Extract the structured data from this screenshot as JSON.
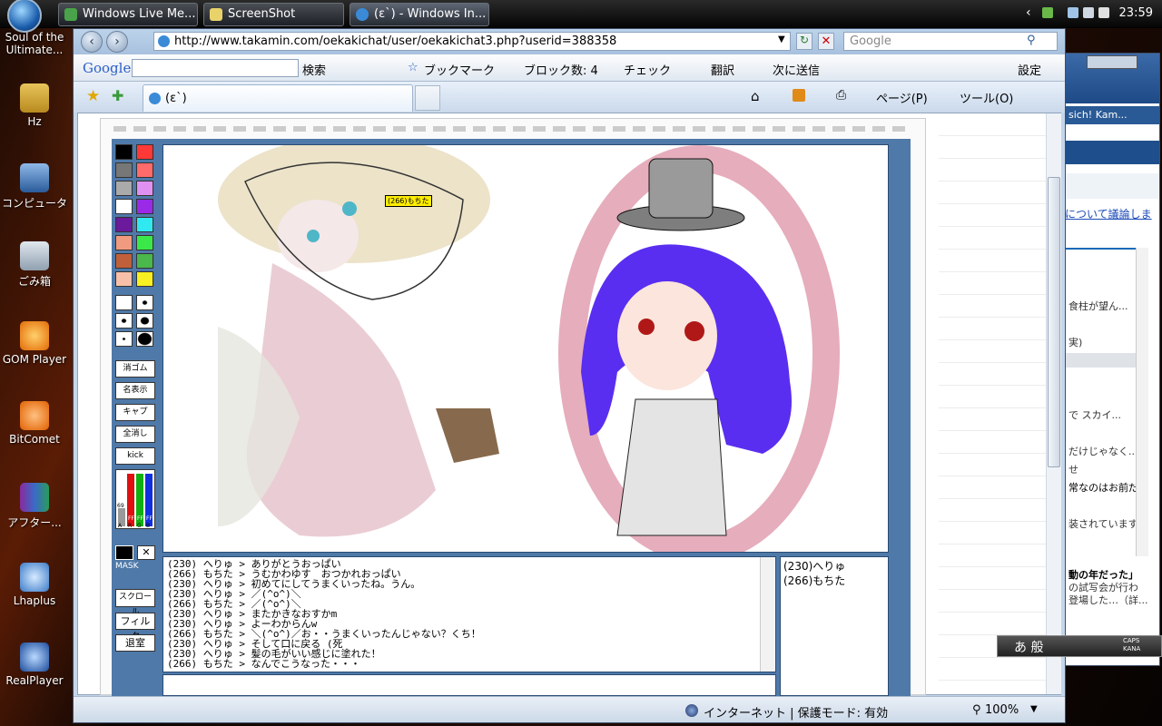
{
  "taskbar": {
    "buttons": [
      "Windows Live Me...",
      "ScreenShot",
      "(ε`) - Windows In..."
    ],
    "clock": "23:59"
  },
  "desktop_icons": [
    {
      "label": "Soul of the Ultimate...",
      "icon": "folder-icon"
    },
    {
      "label": "Hz",
      "icon": "folder-icon"
    },
    {
      "label": "コンピュータ",
      "icon": "computer-icon"
    },
    {
      "label": "ごみ箱",
      "icon": "recycle-bin-icon"
    },
    {
      "label": "GOM Player",
      "icon": "gom-player-icon"
    },
    {
      "label": "BitComet",
      "icon": "bitcomet-icon"
    },
    {
      "label": "アフター...",
      "icon": "archive-icon"
    },
    {
      "label": "Lhaplus",
      "icon": "lhaplus-icon"
    },
    {
      "label": "RealPlayer",
      "icon": "realplayer-icon"
    }
  ],
  "browser": {
    "url": "http://www.takamin.com/oekakichat/user/oekakichat3.php?userid=388358",
    "search_placeholder": "Google",
    "tab_title": "(ε`)",
    "google_bar": {
      "logo": "Google",
      "search_btn": "検索",
      "bookmark": "ブックマーク",
      "block": "ブロック数: 4",
      "check": "チェック",
      "translate": "翻訳",
      "send": "次に送信",
      "settings": "設定"
    },
    "commands": {
      "page": "ページ(P)",
      "tools": "ツール(O)"
    },
    "status": {
      "zone": "インターネット | 保護モード: 有効",
      "zoom": "100%"
    }
  },
  "app": {
    "tool_buttons": [
      "消ゴム",
      "名表示",
      "キャプ",
      "全消し",
      "kick"
    ],
    "mask_label": "MASK",
    "scroll_btn": "スクロール",
    "filter_btn": "フィルタ",
    "exit_btn": "退室",
    "rgb_labels": [
      "A",
      "R",
      "G",
      "B"
    ],
    "rgb_value": "69",
    "rgb_max": [
      "FF",
      "FF",
      "FF"
    ],
    "canvas_tag": "(266)もちた",
    "chat_lines": [
      "(230) へりゅ > ありがとうおっぱい",
      "(266) もちた > うむかわゆす　おつかれおっぱい",
      "(230) へりゅ > 初めてにしてうまくいったね。うん。",
      "(230) へりゅ > ／(^o^)＼",
      "(266) もちた > ／(^o^)＼",
      "(230) へりゅ > またかきなおすかm",
      "(230) へりゅ > よーわからんw",
      "(266) もちた > ＼(^o^)／お・・うまくいったんじゃない？くち！",
      "(230) へりゅ > そして口に戻る (死",
      "(230) へりゅ > 髪の毛がいい感じに塗れた！",
      "(266) もちた > なんでこうなった・・・"
    ],
    "users": [
      "(230)へりゅ",
      "(266)もちた"
    ]
  },
  "side_window": {
    "lines": [
      "sich! Kam...",
      "について議論しま",
      "食柱が望ん...",
      "実)",
      "で スカイ...",
      "だけじゃなく...",
      "せ",
      "常なのはお前だ",
      "装されています...",
      "動の年だった」",
      "の試写会が行わ",
      "登場した…（詳..."
    ]
  },
  "ime": {
    "text": "あ 般",
    "caps": "CAPS",
    "kana": "KANA"
  },
  "colors": {
    "accent": "#4f79a8",
    "window_frame": "#c4d6ea",
    "status_bar": "#ccd9e8"
  }
}
